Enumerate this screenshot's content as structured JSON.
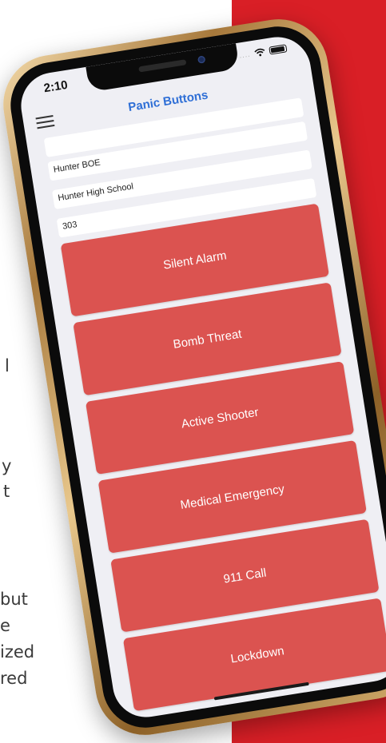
{
  "background": {
    "accent_color": "#d91f26",
    "button_color": "#db5350",
    "title_color": "#2f6fd6"
  },
  "side_text": [
    "l",
    "y",
    "t",
    "but",
    "e",
    "ized",
    "red"
  ],
  "status_bar": {
    "time": "2:10",
    "signal": "....",
    "icons": [
      "wifi-icon",
      "battery-icon"
    ]
  },
  "nav": {
    "title": "Panic Buttons",
    "menu_icon": "hamburger-menu-icon"
  },
  "fields": {
    "top": {
      "value": ""
    },
    "organization": {
      "value": "Hunter BOE"
    },
    "school": {
      "value": "Hunter High School"
    },
    "room": {
      "value": "303"
    }
  },
  "buttons": {
    "silent_alarm": "Silent Alarm",
    "bomb_threat": "Bomb Threat",
    "active_shooter": "Active Shooter",
    "medical_emergency": "Medical Emergency",
    "call_911": "911 Call",
    "lockdown": "Lockdown"
  }
}
